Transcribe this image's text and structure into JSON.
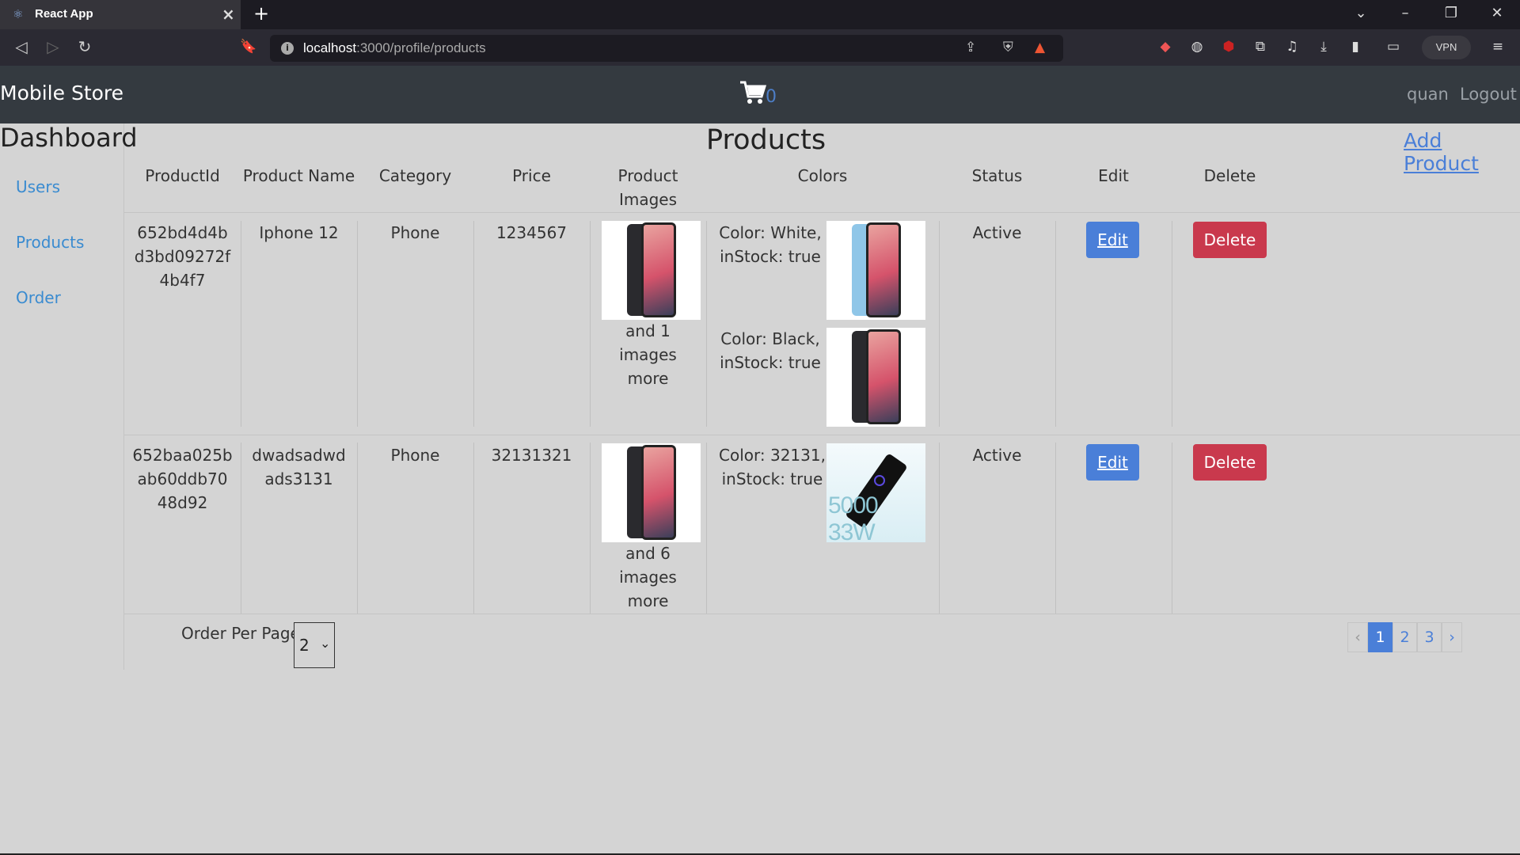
{
  "browser": {
    "tab_title": "React App",
    "url_host": "localhost",
    "url_path": ":3000/profile/products",
    "vpn_label": "VPN"
  },
  "navbar": {
    "brand": "Mobile Store",
    "cart_count": "0",
    "user": "quan",
    "logout": "Logout"
  },
  "sidebar": {
    "title": "Dashboard",
    "items": [
      {
        "label": "Users"
      },
      {
        "label": "Products"
      },
      {
        "label": "Order"
      }
    ]
  },
  "main": {
    "title": "Products",
    "add_product": "Add Product",
    "columns": [
      "ProductId",
      "Product Name",
      "Category",
      "Price",
      "Product Images",
      "Colors",
      "Status",
      "Edit",
      "Delete"
    ],
    "rows": [
      {
        "id": "652bd4d4b d3bd09272f 4b4f7",
        "name": "Iphone 12",
        "category": "Phone",
        "price": "1234567",
        "images_more": "and 1 images more",
        "colors": [
          {
            "text": "Color: White, inStock: true",
            "swatch": "light-blue-phone"
          },
          {
            "text": "Color: Black, inStock: true",
            "swatch": "black-phone"
          }
        ],
        "status": "Active",
        "edit": "Edit",
        "delete": "Delete"
      },
      {
        "id": "652baa025b ab60ddb70 48d92",
        "name": "dwadsadwd ads3131",
        "category": "Phone",
        "price": "32131321",
        "images_more": "and 6 images more",
        "colors": [
          {
            "text": "Color: 32131, inStock: true",
            "swatch": "charging-phone",
            "image_text": "5000 33W"
          }
        ],
        "status": "Active",
        "edit": "Edit",
        "delete": "Delete"
      }
    ]
  },
  "pagination": {
    "per_page_label": "Order Per Page",
    "per_page_value": "2",
    "prev": "‹",
    "pages": [
      "1",
      "2",
      "3"
    ],
    "active_page": "1",
    "next": "›"
  },
  "colors": {
    "navbar_bg": "#343a40",
    "page_bg": "#d4d4d4",
    "link": "#3a8bd0",
    "edit_button": "#4a7fd8",
    "delete_button": "#c9394d"
  }
}
